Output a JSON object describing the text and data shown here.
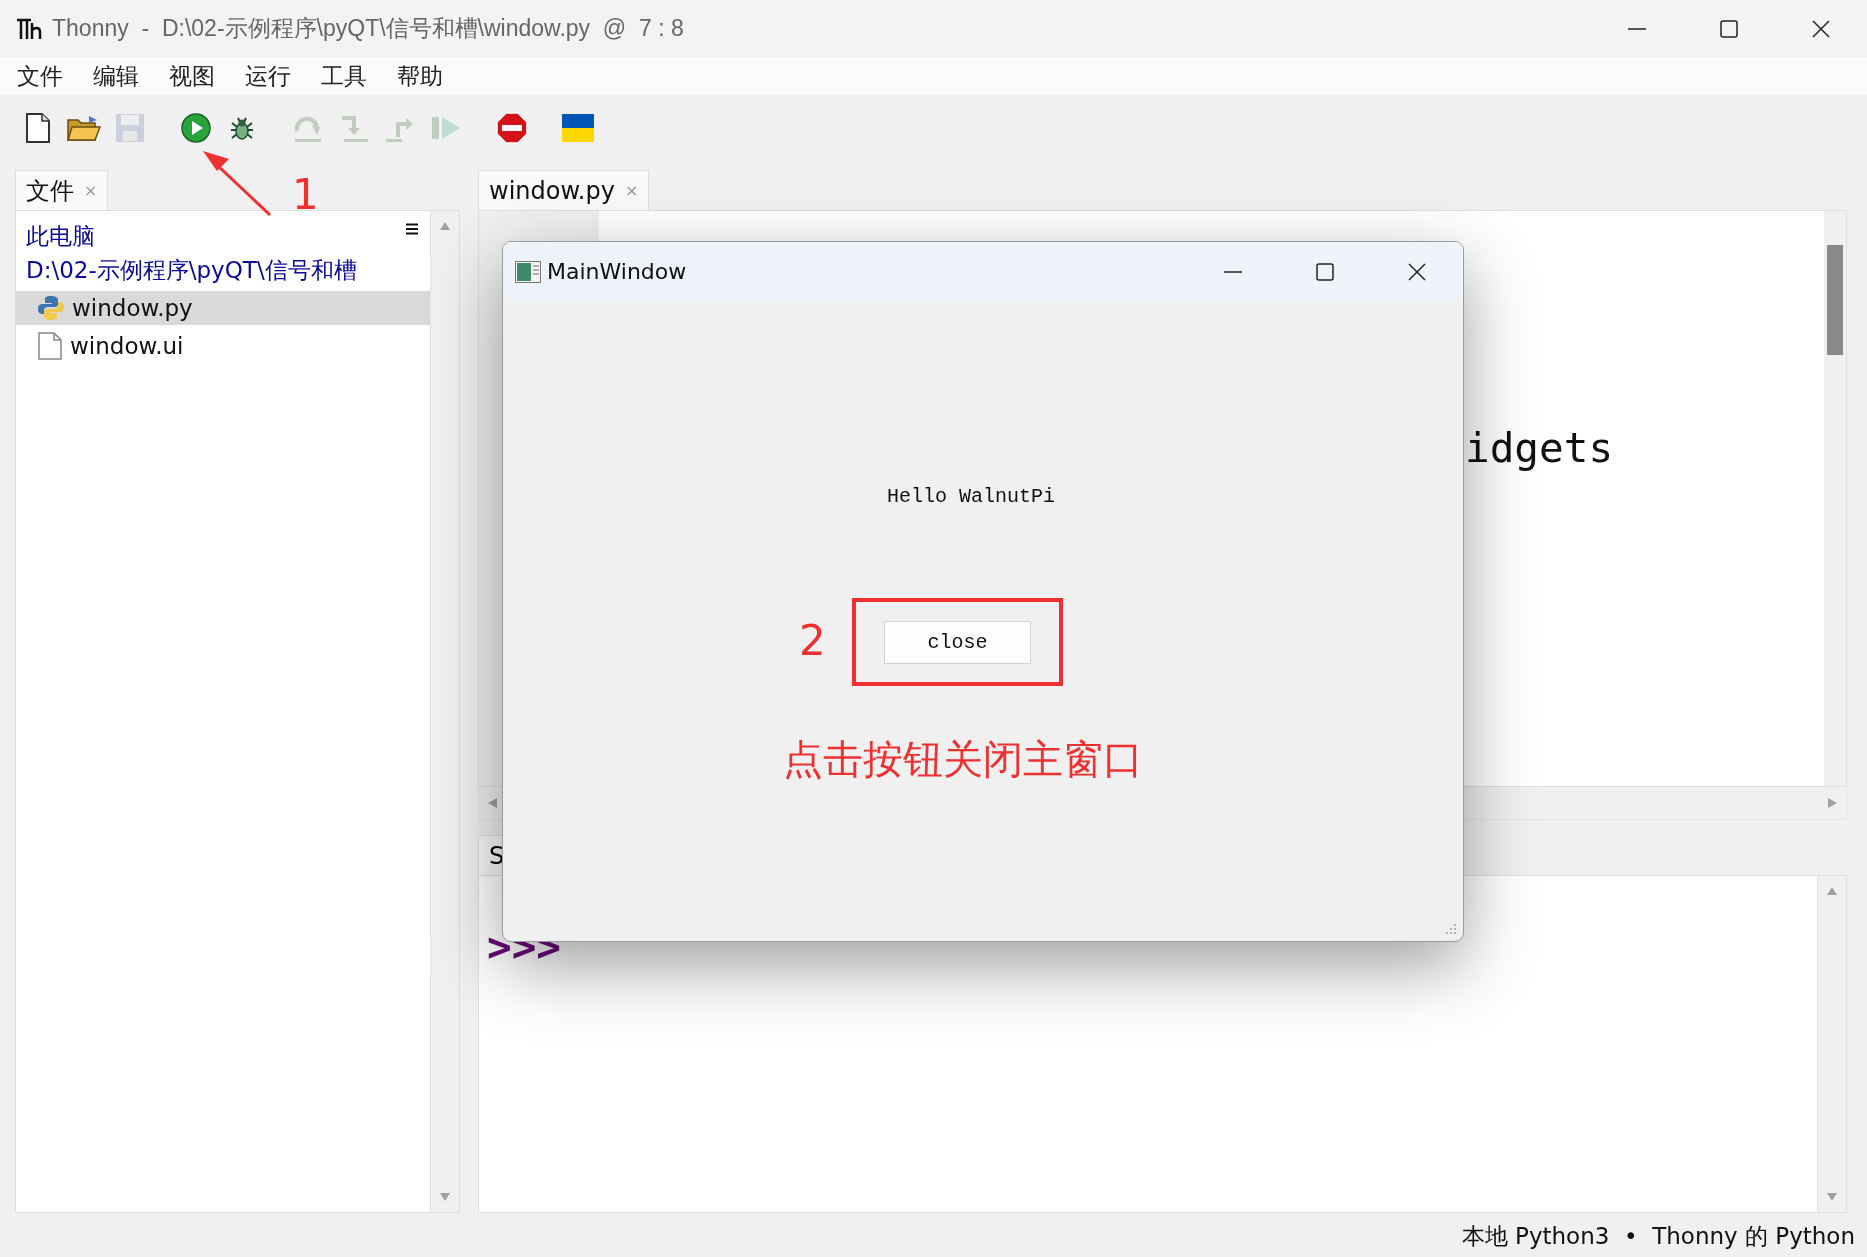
{
  "window": {
    "title": "Thonny  -  D:\\02-示例程序\\pyQT\\信号和槽\\window.py  @  7 : 8"
  },
  "menu": [
    "文件",
    "编辑",
    "视图",
    "运行",
    "工具",
    "帮助"
  ],
  "toolbar": [
    [
      {
        "kind": "new",
        "disabled": false
      },
      {
        "kind": "open",
        "disabled": false
      },
      {
        "kind": "save",
        "disabled": true
      }
    ],
    [
      {
        "kind": "run",
        "disabled": false
      },
      {
        "kind": "debug",
        "disabled": false
      }
    ],
    [
      {
        "kind": "step-over",
        "disabled": true
      },
      {
        "kind": "step-into",
        "disabled": true
      },
      {
        "kind": "step-out",
        "disabled": true
      },
      {
        "kind": "resume",
        "disabled": true
      }
    ],
    [
      {
        "kind": "stop",
        "disabled": false
      }
    ],
    [
      {
        "kind": "flag",
        "disabled": false
      }
    ]
  ],
  "files_panel": {
    "tabs": [
      {
        "label": "文件",
        "close": "×",
        "selected": true
      }
    ],
    "location": "此电脑",
    "path": "D:\\02-示例程序\\pyQT\\信号和槽",
    "items": [
      {
        "name": "window.py",
        "kind": "python",
        "selected": true
      },
      {
        "name": "window.ui",
        "kind": "file",
        "selected": false
      }
    ]
  },
  "editor": {
    "tabs": [
      {
        "label": "window.py",
        "close": "×",
        "selected": true
      }
    ],
    "fragment": "idgets"
  },
  "shell": {
    "tab": "S",
    "prompt": ">>>"
  },
  "status_bar": "本地 Python3  •  Thonny 的 Python",
  "dialog": {
    "title": "MainWindow",
    "label": "Hello WalnutPi",
    "button": "close"
  },
  "annotations": {
    "arrow_number": "1",
    "box_number": "2",
    "caption": "点击按钮关闭主窗口"
  }
}
